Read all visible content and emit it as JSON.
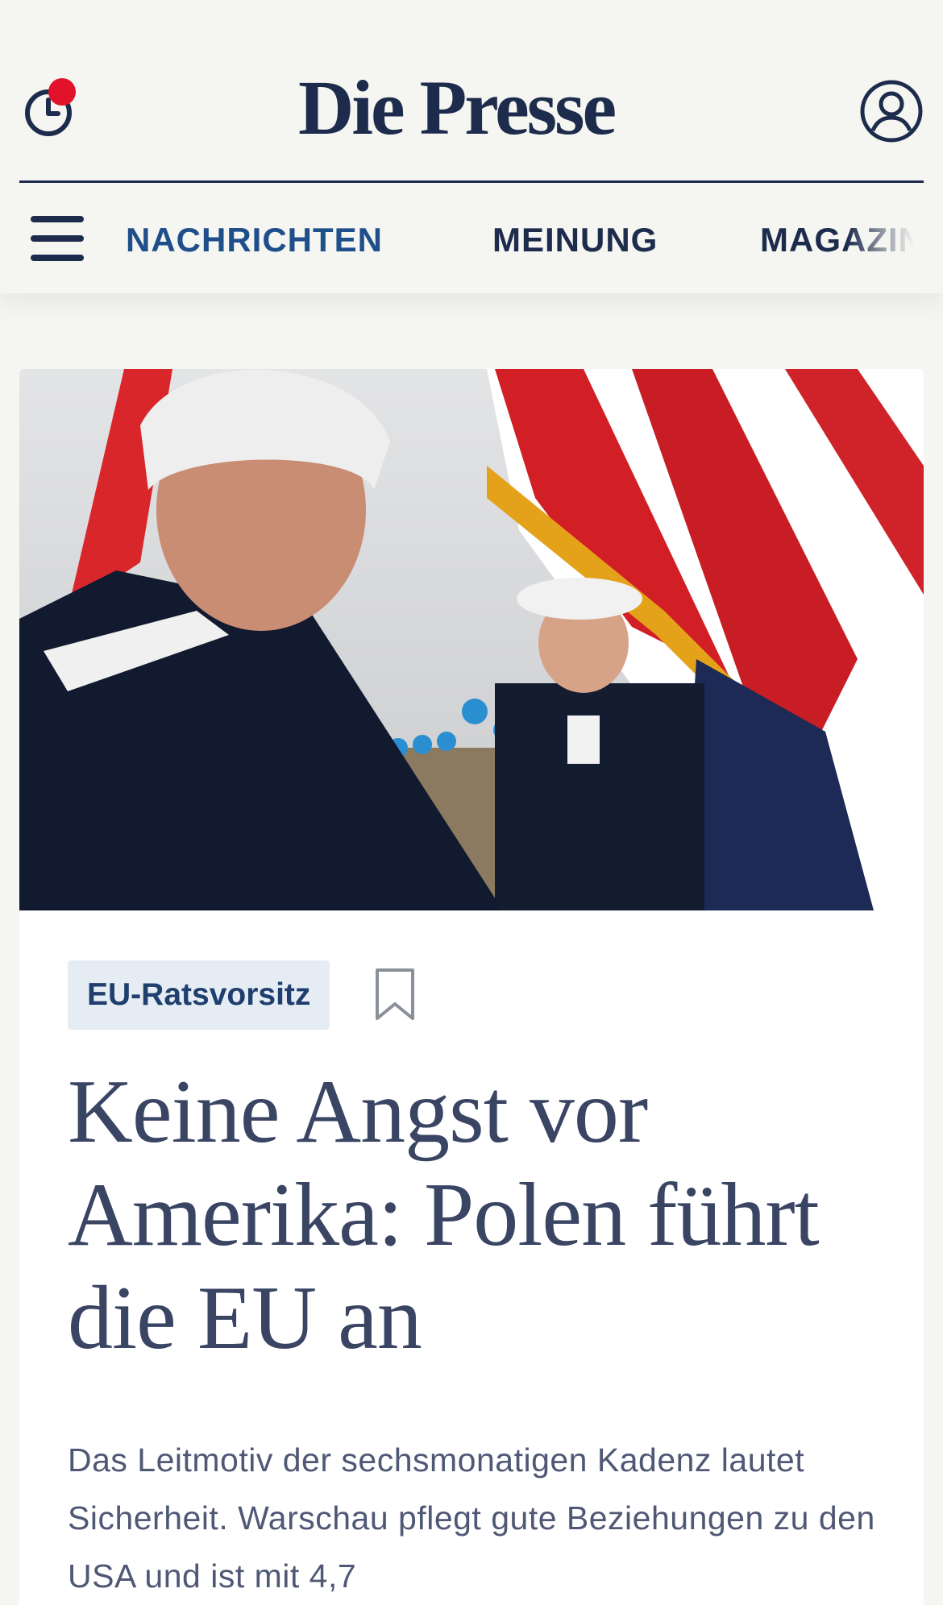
{
  "header": {
    "logo": "Die Presse"
  },
  "nav": {
    "items": [
      {
        "label": "NACHRICHTEN",
        "active": true
      },
      {
        "label": "MEINUNG",
        "active": false
      },
      {
        "label": "MAGAZIN",
        "active": false
      }
    ]
  },
  "article": {
    "tag": "EU-Ratsvorsitz",
    "headline": "Keine Angst vor Amerika: Polen führt die EU an",
    "lead": "Das Leitmotiv der sechsmonatigen Kadenz lautet Sicherheit. Warschau pflegt gute Beziehungen zu den USA und ist mit 4,7"
  },
  "colors": {
    "brand": "#1d2b4c",
    "active_nav": "#1f4f8a",
    "notification": "#e1122a",
    "tag_background": "#e6ecf3"
  }
}
